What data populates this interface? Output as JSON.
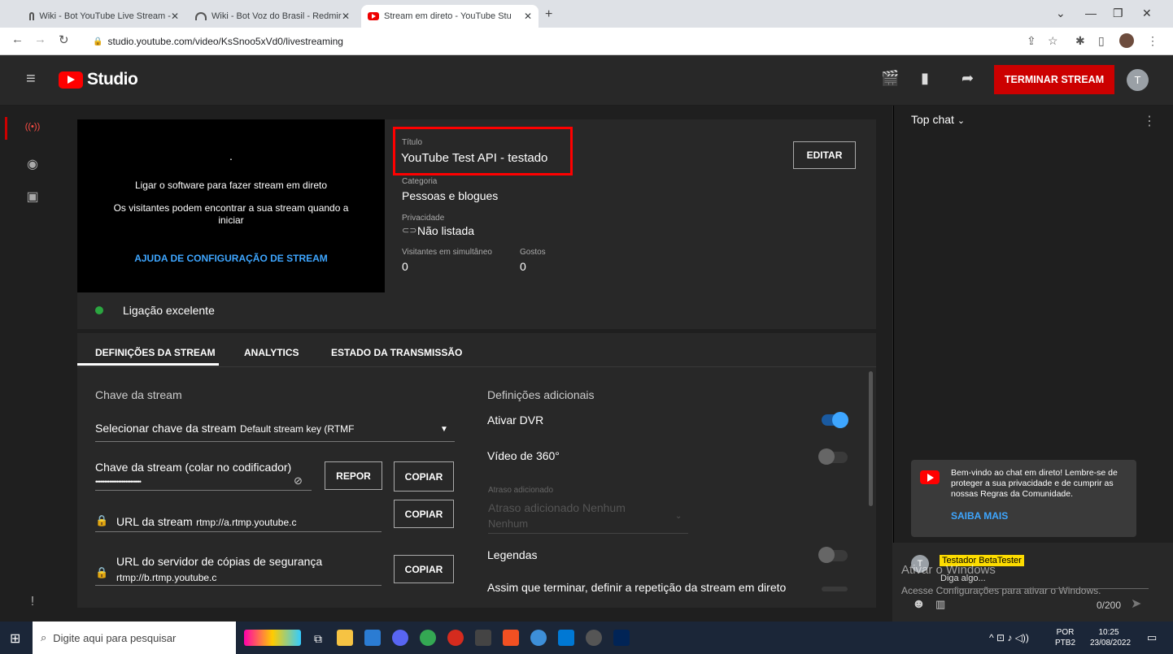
{
  "browser": {
    "tabs": [
      {
        "title": "Wiki - Bot YouTube Live Stream -",
        "close": "✕"
      },
      {
        "title": "Wiki - Bot Voz do Brasil - Redmir",
        "close": "✕"
      },
      {
        "title": "Stream em direto - YouTube Stu",
        "close": "✕"
      }
    ],
    "new_tab": "+",
    "url": "studio.youtube.com/video/KsSnoo5xVd0/livestreaming"
  },
  "header": {
    "logo_text": "Studio",
    "end_stream_label": "TERMINAR STREAM",
    "avatar_letter": "T"
  },
  "preview": {
    "dot": "·",
    "line1": "Ligar o software para fazer stream em direto",
    "line2": "Os visitantes podem encontrar a sua stream quando a",
    "line3": "iniciar",
    "help_link": "AJUDA DE CONFIGURAÇÃO DE STREAM"
  },
  "info": {
    "title_label": "Título",
    "title_value": "YouTube Test API - testado",
    "category_label": "Categoria",
    "category_value": "Pessoas e blogues",
    "privacy_label": "Privacidade",
    "privacy_value": "Não listada",
    "viewers_label": "Visitantes em simultâneo",
    "viewers_value": "0",
    "likes_label": "Gostos",
    "likes_value": "0",
    "edit_label": "EDITAR",
    "connection": "Ligação excelente"
  },
  "tabs": {
    "settings": "DEFINIÇÕES DA STREAM",
    "analytics": "ANALYTICS",
    "status": "ESTADO DA TRANSMISSÃO"
  },
  "stream_key": {
    "section": "Chave da stream",
    "select_label": "Selecionar chave da stream",
    "select_value": "Default stream key (RTMF",
    "key_label": "Chave da stream (colar no codificador)",
    "key_value": "••••••••••••••••••••••••••",
    "reset_label": "REPOR",
    "copy_label": "COPIAR",
    "url_label": "URL da stream",
    "url_value": "rtmp://a.rtmp.youtube.c",
    "backup_label": "URL do servidor de cópias de segurança",
    "backup_value": "rtmp://b.rtmp.youtube.c"
  },
  "additional": {
    "section": "Definições adicionais",
    "dvr": "Ativar DVR",
    "dvr_on": true,
    "video360": "Vídeo de 360°",
    "delay_small": "Atraso adicionado",
    "delay_label": "Atraso adicionado Nenhum",
    "delay_value": "Nenhum",
    "captions": "Legendas",
    "replay": "Assim que terminar, definir a repetição da stream em direto"
  },
  "chat": {
    "header": "Top chat",
    "banner": "Bem-vindo ao chat em direto! Lembre-se de proteger a sua privacidade e de cumprir as nossas Regras da Comunidade.",
    "learn_more": "SAIBA MAIS",
    "user_badge": "Testador BetaTester",
    "user_avatar": "T",
    "placeholder": "Diga algo...",
    "counter": "0/200",
    "watermark1": "Ativar o Windows",
    "watermark2": "Acesse Configurações para ativar o Windows."
  },
  "taskbar": {
    "search_placeholder": "Digite aqui para pesquisar",
    "lang1": "POR",
    "lang2": "PTB2",
    "time": "10:25",
    "date": "23/08/2022"
  },
  "colors": {
    "accent_red": "#cc0000",
    "link_blue": "#3ea6ff",
    "status_green": "#2ba640",
    "highlight_box": "#ff0000"
  }
}
